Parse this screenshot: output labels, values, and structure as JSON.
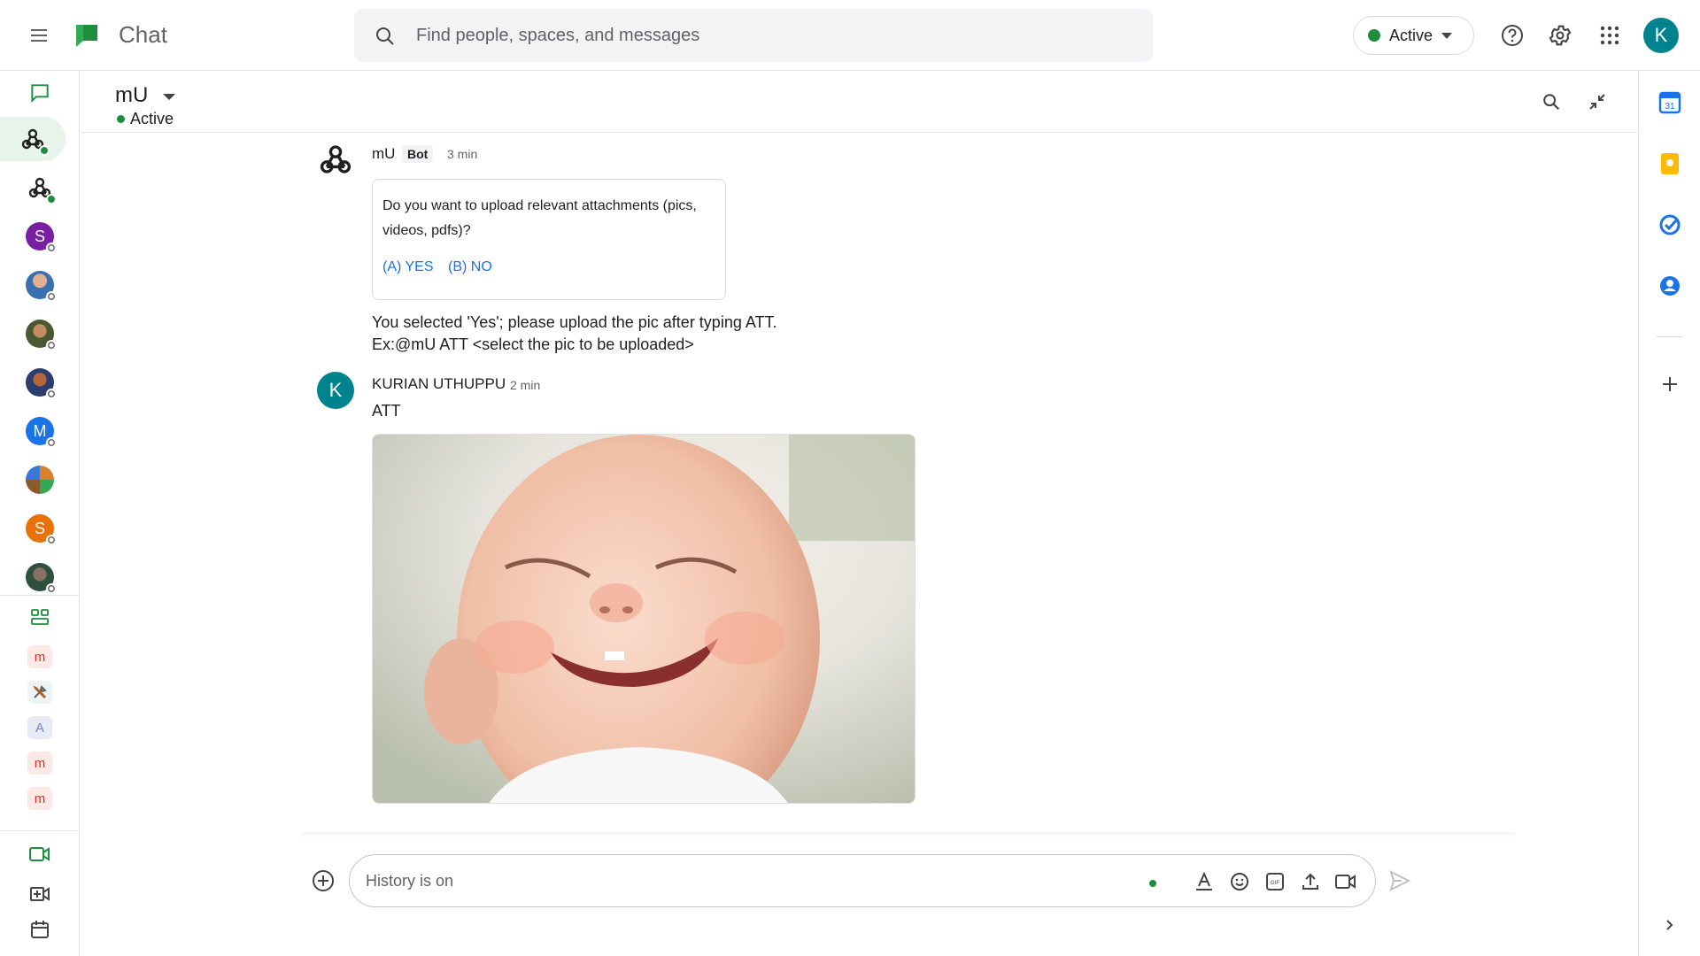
{
  "app": {
    "title": "Chat"
  },
  "search": {
    "placeholder": "Find people, spaces, and messages"
  },
  "status": {
    "label": "Active"
  },
  "account": {
    "initial": "K"
  },
  "rail": {
    "dm_avatars": [
      {
        "letter": "S",
        "color": "#7b1fa2"
      },
      {
        "letter": "M",
        "color": "#1a73e8"
      },
      {
        "letter": "S",
        "color": "#e8710a"
      }
    ],
    "spaces": [
      {
        "letter": "m",
        "bg": "#fce8e6",
        "fg": "#d93025"
      },
      {
        "letter": "A",
        "bg": "#e8eaf6",
        "fg": "#7986cb"
      },
      {
        "letter": "m",
        "bg": "#fce8e6",
        "fg": "#d93025"
      },
      {
        "letter": "m",
        "bg": "#fce8e6",
        "fg": "#d93025"
      }
    ]
  },
  "conversation": {
    "name": "mU",
    "status": "Active"
  },
  "messages": [
    {
      "sender": "mU",
      "badge": "Bot",
      "time": "3 min",
      "card": {
        "text": "Do you want to upload relevant attachments (pics, videos, pdfs)?",
        "buttons": [
          "(A) YES",
          "(B) NO"
        ]
      },
      "text_lines": [
        "You selected 'Yes'; please upload the pic after typing ATT.",
        "Ex:@mU ATT <select the pic to be uploaded>"
      ]
    },
    {
      "sender": "KURIAN UTHUPPU",
      "avatar_initial": "K",
      "time": "2 min",
      "text": "ATT"
    }
  ],
  "composer": {
    "placeholder": "History is on"
  },
  "colors": {
    "accent": "#1a73e8",
    "active": "#1e8e3e",
    "avatar": "#00838f"
  }
}
